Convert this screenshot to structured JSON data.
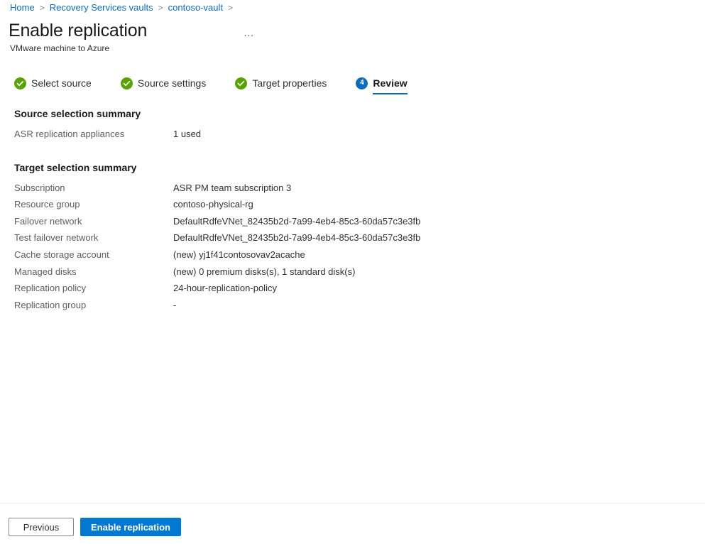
{
  "breadcrumb": {
    "items": [
      {
        "label": "Home"
      },
      {
        "label": "Recovery Services vaults"
      },
      {
        "label": "contoso-vault"
      }
    ],
    "separator": ">"
  },
  "header": {
    "title": "Enable replication",
    "subtitle": "VMware machine to Azure",
    "more_menu": "…"
  },
  "wizard": {
    "tabs": [
      {
        "label": "Select source",
        "state": "done",
        "badge": "check"
      },
      {
        "label": "Source settings",
        "state": "done",
        "badge": "check"
      },
      {
        "label": "Target properties",
        "state": "done",
        "badge": "check"
      },
      {
        "label": "Review",
        "state": "active",
        "badge": "4"
      }
    ]
  },
  "sections": [
    {
      "heading": "Source selection summary",
      "rows": [
        {
          "label": "ASR replication appliances",
          "value": "1 used"
        }
      ]
    },
    {
      "heading": "Target selection summary",
      "rows": [
        {
          "label": "Subscription",
          "value": "ASR PM team subscription 3"
        },
        {
          "label": "Resource group",
          "value": "contoso-physical-rg"
        },
        {
          "label": "Failover network",
          "value": "DefaultRdfeVNet_82435b2d-7a99-4eb4-85c3-60da57c3e3fb"
        },
        {
          "label": "Test failover network",
          "value": "DefaultRdfeVNet_82435b2d-7a99-4eb4-85c3-60da57c3e3fb"
        },
        {
          "label": "Cache storage account",
          "value": "(new) yj1f41contosovav2acache"
        },
        {
          "label": "Managed disks",
          "value": "(new) 0 premium disks(s), 1 standard disk(s)"
        },
        {
          "label": "Replication policy",
          "value": "24-hour-replication-policy"
        },
        {
          "label": "Replication group",
          "value": "-"
        }
      ]
    }
  ],
  "footer": {
    "previous_label": "Previous",
    "submit_label": "Enable replication"
  },
  "colors": {
    "accent": "#0078d4",
    "link": "#0f6cbd",
    "success": "#57a300",
    "text": "#323130",
    "muted": "#605e5c",
    "divider": "#edebe9"
  }
}
